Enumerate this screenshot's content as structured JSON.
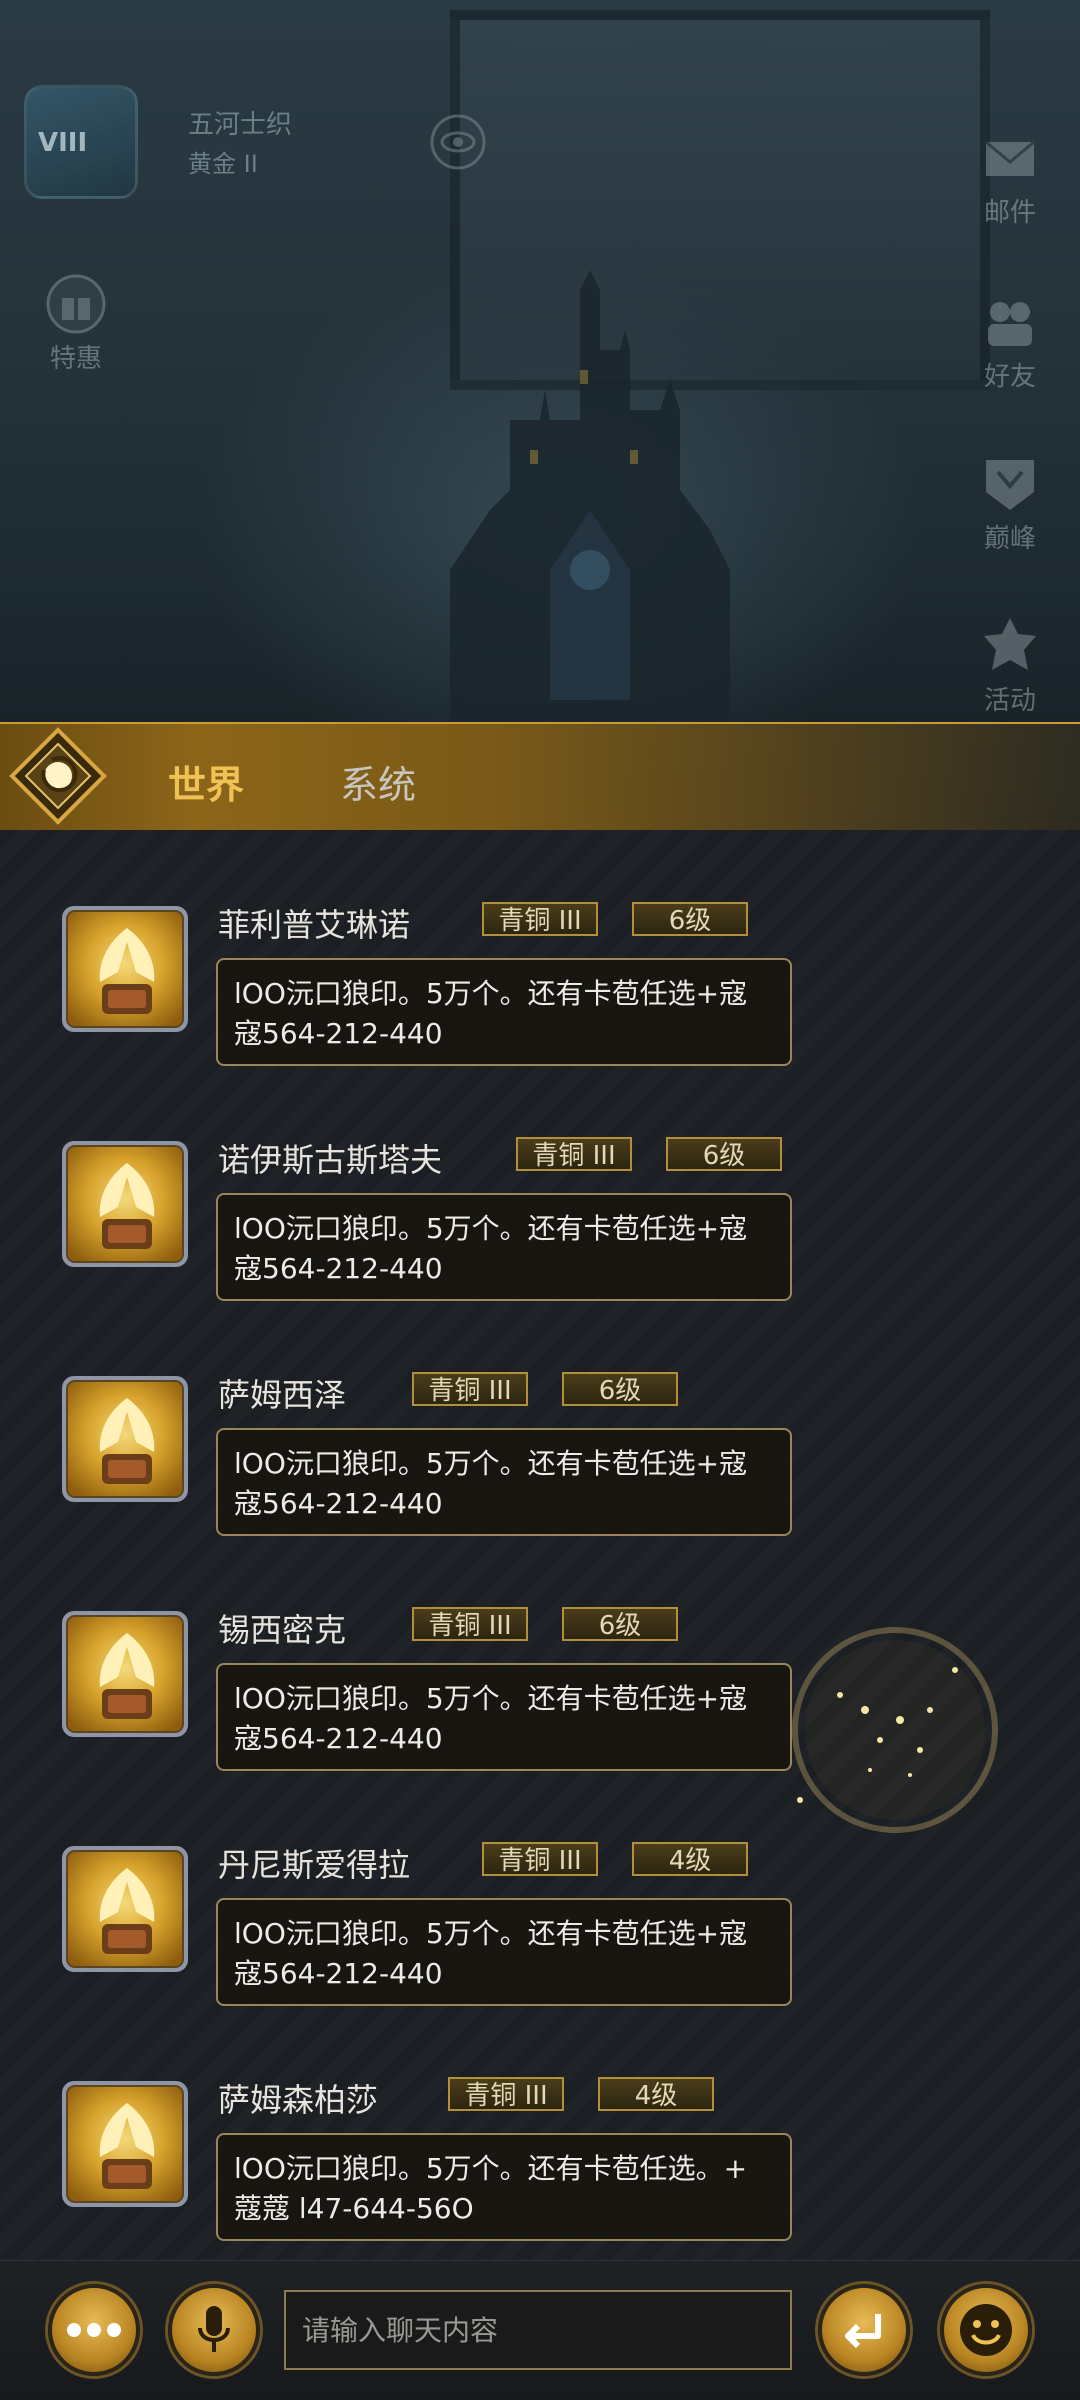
{
  "player": {
    "avatar_text": "VIII",
    "name": "五河士织",
    "rank": "黄金 II"
  },
  "side_buttons": {
    "left": [
      {
        "label": "特惠",
        "icon": "gift-icon"
      }
    ],
    "right": [
      {
        "label": "邮件",
        "icon": "mail-icon"
      },
      {
        "label": "好友",
        "icon": "friends-icon"
      },
      {
        "label": "巅峰",
        "icon": "peak-icon"
      },
      {
        "label": "活动",
        "icon": "event-icon"
      }
    ]
  },
  "tabs": [
    {
      "label": "世界",
      "active": true
    },
    {
      "label": "系统",
      "active": false
    }
  ],
  "messages": [
    {
      "name": "菲利普艾琳诺",
      "rank": "青铜 III",
      "level": "6级",
      "line1": "lOO沅口狼印。5万个。还有卡苞任选+寇",
      "line2": "寇564-212-440"
    },
    {
      "name": "诺伊斯古斯塔夫",
      "rank": "青铜 III",
      "level": "6级",
      "line1": "lOO沅口狼印。5万个。还有卡苞任选+寇",
      "line2": "寇564-212-440"
    },
    {
      "name": "萨姆西泽",
      "rank": "青铜 III",
      "level": "6级",
      "line1": "lOO沅口狼印。5万个。还有卡苞任选+寇",
      "line2": "寇564-212-440"
    },
    {
      "name": "锡西密克",
      "rank": "青铜 III",
      "level": "6级",
      "line1": "lOO沅口狼印。5万个。还有卡苞任选+寇",
      "line2": "寇564-212-440"
    },
    {
      "name": "丹尼斯爱得拉",
      "rank": "青铜 III",
      "level": "4级",
      "line1": "lOO沅口狼印。5万个。还有卡苞任选+寇",
      "line2": "寇564-212-440"
    },
    {
      "name": "萨姆森柏莎",
      "rank": "青铜 III",
      "level": "4级",
      "line1": "lOO沅口狼印。5万个。还有卡苞任选。+",
      "line2": "蔻蔻 l47-644-56O"
    }
  ],
  "input": {
    "placeholder": "请输入聊天内容"
  },
  "bottom_icons": [
    "more-icon",
    "microphone-icon",
    "send-icon",
    "emoji-icon"
  ],
  "colors": {
    "accent_gold": "#f0c256",
    "bubble_border": "#9a8658",
    "badge_border": "#b38f3a"
  }
}
